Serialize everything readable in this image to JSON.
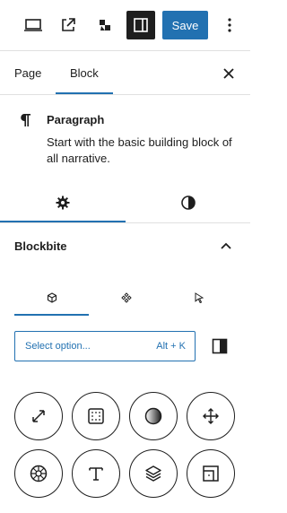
{
  "toolbar": {
    "save_label": "Save",
    "icons": [
      "laptop-icon",
      "external-link-icon",
      "jetpack-icon",
      "sidebar-toggle-icon",
      "more-vertical-icon"
    ]
  },
  "tabs": {
    "page_label": "Page",
    "block_label": "Block",
    "active": "Block"
  },
  "block": {
    "icon": "paragraph-icon",
    "title": "Paragraph",
    "description": "Start with the basic building block of all narrative."
  },
  "settings_tabs": {
    "items": [
      "settings-gear-icon",
      "styles-contrast-icon"
    ],
    "active": "settings-gear-icon"
  },
  "panel": {
    "title": "Blockbite",
    "subtabs": [
      "cube-icon",
      "component-icon",
      "cursor-icon"
    ],
    "active_subtab": "cube-icon"
  },
  "select": {
    "placeholder": "Select option...",
    "shortcut": "Alt + K"
  },
  "tools": [
    "expand-icon",
    "padding-dots-icon",
    "gradient-circle-icon",
    "move-arrows-icon",
    "aperture-icon",
    "typography-icon",
    "layers-icon",
    "frame-icon"
  ],
  "colors": {
    "accent": "#2271b1",
    "text": "#1e1e1e",
    "divider": "#e0e0e0"
  }
}
